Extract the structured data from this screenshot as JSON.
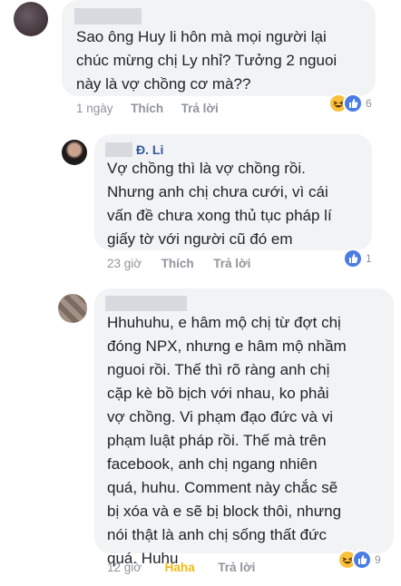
{
  "comments": [
    {
      "author": "",
      "text": "Sao ông Huy li hôn mà mọi người lại\nchúc mừng chị Ly nhỉ? Tưởng 2 nguoi\nnày là vợ chồng cơ mà??",
      "time": "1 ngày",
      "like": "Thích",
      "reply": "Trả lời",
      "reactions": [
        "haha",
        "like"
      ],
      "count": "6"
    },
    {
      "author": "Đ. Li",
      "text": "Vợ chồng thì là vợ chồng rồi.\nNhưng anh chị chưa cưới, vì cái\nvấn đề chưa xong thủ tục pháp lí\ngiấy tờ với người cũ đó em",
      "time": "23 giờ",
      "like": "Thích",
      "reply": "Trả lời",
      "reactions": [
        "like"
      ],
      "count": "1"
    },
    {
      "author": "",
      "text": "Hhuhuhu, e hâm mộ chị từ đợt chị\nđóng NPX, nhưng e hâm mộ nhầm\nnguoi rồi. Thế thì rõ ràng anh chị\ncặp kè bồ bịch với nhau, ko phải\nvợ chồng. Vi phạm đạo đức và vi\nphạm luật pháp rồi. Thế mà trên\nfacebook, anh chị  ngang nhiên\nquá, huhu. Comment này chắc sẽ\nbị xóa và e sẽ bị block thôi, nhưng\nnói thật là anh chị sống thất đức\nquá. Huhu",
      "time": "12 giờ",
      "like": "Haha",
      "reply": "Trả lời",
      "reactions": [
        "haha",
        "like"
      ],
      "count": "9"
    }
  ]
}
